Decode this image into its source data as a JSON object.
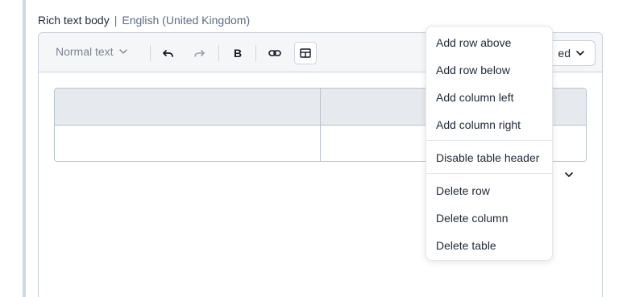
{
  "field": {
    "label": "Rich text body",
    "separator": "|",
    "locale": "English (United Kingdom)"
  },
  "toolbar": {
    "text_style": "Normal text",
    "status_partial": "ed",
    "icons": [
      "undo-icon",
      "redo-icon",
      "bold-icon",
      "link-icon",
      "table-icon"
    ],
    "bold_glyph": "B"
  },
  "table_menu": {
    "items": [
      "Add row above",
      "Add row below",
      "Add column left",
      "Add column right",
      "Disable table header",
      "Delete row",
      "Delete column",
      "Delete table"
    ]
  }
}
